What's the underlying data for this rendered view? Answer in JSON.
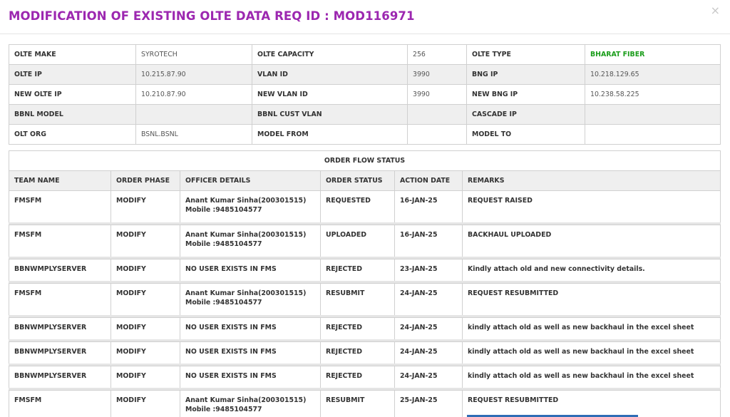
{
  "modal": {
    "title": "MODIFICATION OF EXISTING OLTE DATA REQ ID : MOD116971",
    "close": "×"
  },
  "info_rows": [
    [
      {
        "label": "OLTE MAKE",
        "value": "SYROTECH"
      },
      {
        "label": "OLTE CAPACITY",
        "value": "256"
      },
      {
        "label": "OLTE TYPE",
        "value": "BHARAT FIBER"
      }
    ],
    [
      {
        "label": "OLTE IP",
        "value": "10.215.87.90"
      },
      {
        "label": "VLAN ID",
        "value": "3990"
      },
      {
        "label": "BNG IP",
        "value": "10.218.129.65"
      }
    ],
    [
      {
        "label": "NEW OLTE IP",
        "value": "10.210.87.90"
      },
      {
        "label": "NEW VLAN ID",
        "value": "3990"
      },
      {
        "label": "NEW BNG IP",
        "value": "10.238.58.225"
      }
    ],
    [
      {
        "label": "BBNL MODEL",
        "value": ""
      },
      {
        "label": "BBNL CUST VLAN",
        "value": ""
      },
      {
        "label": "CASCADE IP",
        "value": ""
      }
    ],
    [
      {
        "label": "OLT ORG",
        "value": "BSNL.BSNL"
      },
      {
        "label": "MODEL FROM",
        "value": ""
      },
      {
        "label": "MODEL TO",
        "value": ""
      }
    ]
  ],
  "order_flow": {
    "caption": "ORDER FLOW STATUS",
    "headers": [
      "TEAM NAME",
      "ORDER PHASE",
      "OFFICER DETAILS",
      "ORDER STATUS",
      "ACTION DATE",
      "REMARKS"
    ],
    "rows": [
      {
        "team": "FMSFM",
        "phase": "MODIFY",
        "officer": "Anant Kumar Sinha(200301515)",
        "mobile": "Mobile :9485104577",
        "status": "REQUESTED",
        "date": "16-JAN-25",
        "remarks": "REQUEST RAISED"
      },
      {
        "team": "FMSFM",
        "phase": "MODIFY",
        "officer": "Anant Kumar Sinha(200301515)",
        "mobile": "Mobile :9485104577",
        "status": "UPLOADED",
        "date": "16-JAN-25",
        "remarks": "BACKHAUL UPLOADED"
      },
      {
        "team": "BBNWMPLYSERVER",
        "phase": "MODIFY",
        "officer": "NO USER EXISTS IN FMS",
        "mobile": "",
        "status": "REJECTED",
        "date": "23-JAN-25",
        "remarks": "Kindly attach old and new connectivity details."
      },
      {
        "team": "FMSFM",
        "phase": "MODIFY",
        "officer": "Anant Kumar Sinha(200301515)",
        "mobile": "Mobile :9485104577",
        "status": "RESUBMIT",
        "date": "24-JAN-25",
        "remarks": "REQUEST RESUBMITTED"
      },
      {
        "team": "BBNWMPLYSERVER",
        "phase": "MODIFY",
        "officer": "NO USER EXISTS IN FMS",
        "mobile": "",
        "status": "REJECTED",
        "date": "24-JAN-25",
        "remarks": "kindly attach old as well as new backhaul in the excel sheet"
      },
      {
        "team": "BBNWMPLYSERVER",
        "phase": "MODIFY",
        "officer": "NO USER EXISTS IN FMS",
        "mobile": "",
        "status": "REJECTED",
        "date": "24-JAN-25",
        "remarks": "kindly attach old as well as new backhaul in the excel sheet"
      },
      {
        "team": "BBNWMPLYSERVER",
        "phase": "MODIFY",
        "officer": "NO USER EXISTS IN FMS",
        "mobile": "",
        "status": "REJECTED",
        "date": "24-JAN-25",
        "remarks": "kindly attach old as well as new backhaul in the excel sheet"
      },
      {
        "team": "FMSFM",
        "phase": "MODIFY",
        "officer": "Anant Kumar Sinha(200301515)",
        "mobile": "Mobile :9485104577",
        "status": "RESUBMIT",
        "date": "25-JAN-25",
        "remarks": "REQUEST RESUBMITTED"
      }
    ]
  },
  "colors": {
    "title": "#9c27b0",
    "olte_type": "#1a9d1a",
    "header_bg": "#efefef",
    "link_bar": "#2f6db5"
  }
}
